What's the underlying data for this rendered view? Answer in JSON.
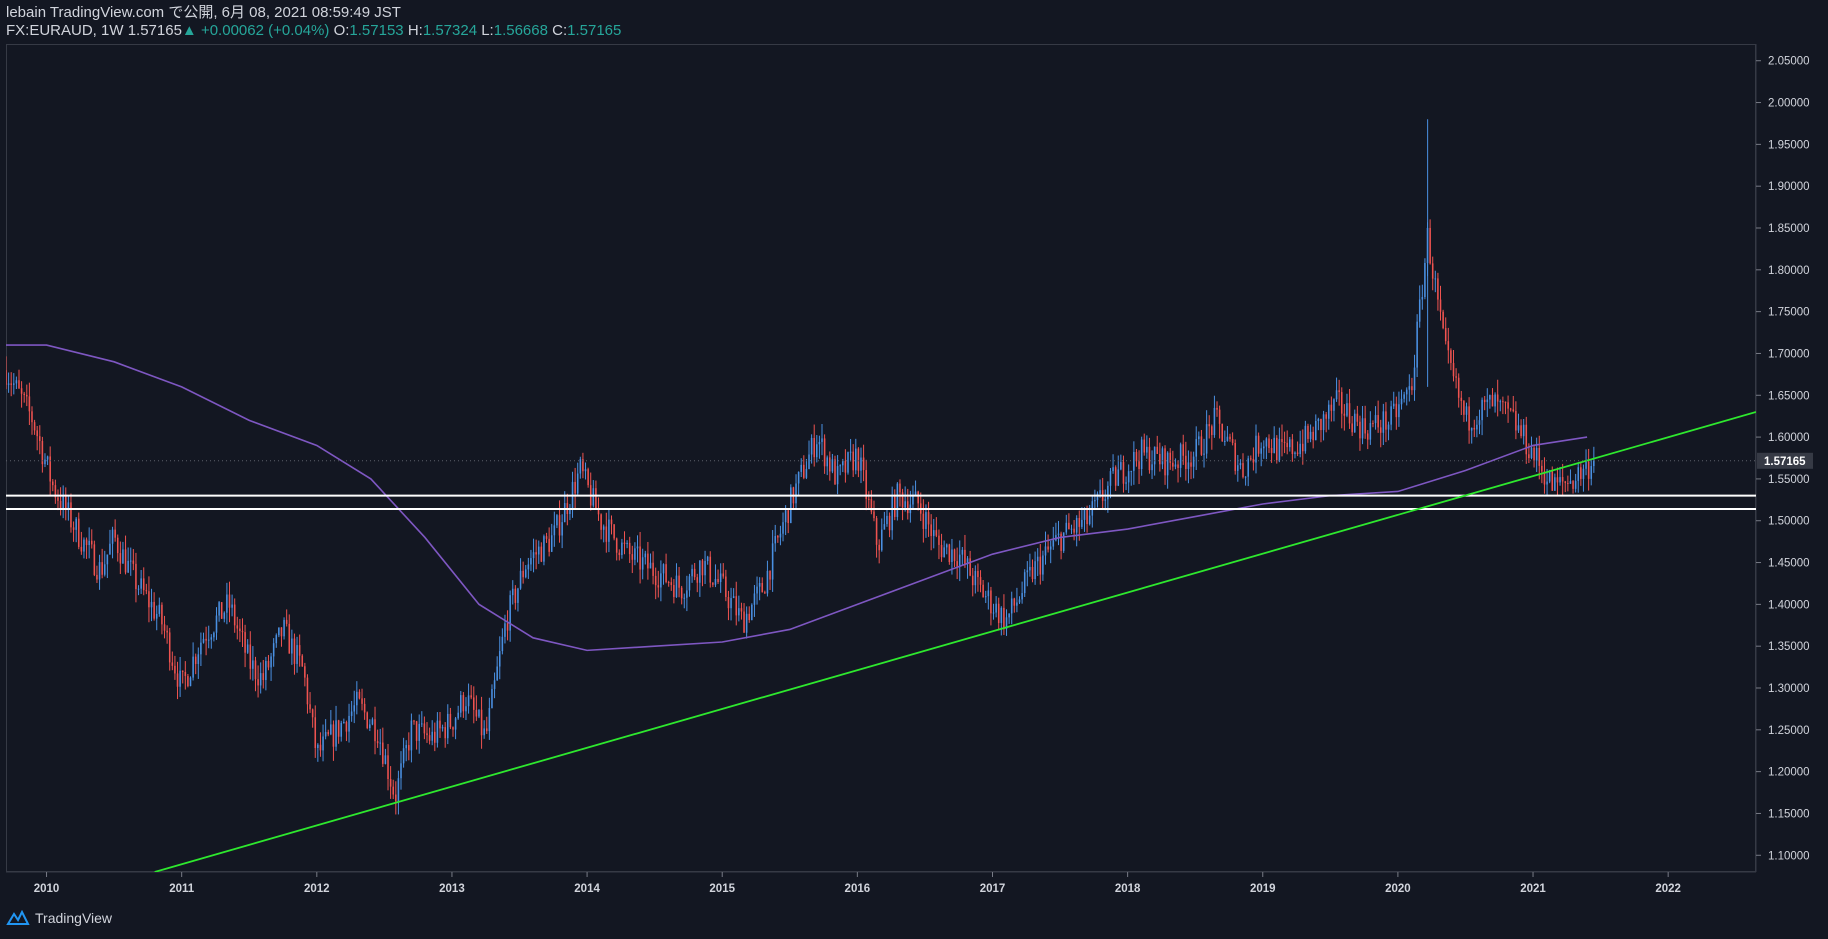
{
  "header": {
    "published_line": "lebain TradingView.com で公開, 6月 08, 2021 08:59:49 JST",
    "symbol": "FX:EURAUD, 1W",
    "last": "1.57165",
    "change": "+0.00062 (+0.04%)",
    "open_label": "O:",
    "open": "1.57153",
    "high_label": "H:",
    "high": "1.57324",
    "low_label": "L:",
    "low": "1.56668",
    "close_label": "C:",
    "close": "1.57165",
    "up_marker": "▲"
  },
  "footer": {
    "brand": "TradingView"
  },
  "colors": {
    "background": "#131722",
    "up": "#4a90e2",
    "down": "#ef5350",
    "ma": "#7e57c2",
    "trendline": "#2ee82e",
    "hline": "#ffffff",
    "ohlc_values": "#26a69a",
    "axis_text": "#d1d4dc"
  },
  "chart_data": {
    "type": "candlestick",
    "symbol": "FX:EURAUD",
    "interval": "1W",
    "x_range": [
      2009.7,
      2022.65
    ],
    "ylim": [
      1.08,
      2.07
    ],
    "y_ticks": [
      "2.05000",
      "2.00000",
      "1.95000",
      "1.90000",
      "1.85000",
      "1.80000",
      "1.75000",
      "1.70000",
      "1.65000",
      "1.60000",
      "1.55000",
      "1.50000",
      "1.45000",
      "1.40000",
      "1.35000",
      "1.30000",
      "1.25000",
      "1.20000",
      "1.15000",
      "1.10000"
    ],
    "x_ticks": [
      "2010",
      "2011",
      "2012",
      "2013",
      "2014",
      "2015",
      "2016",
      "2017",
      "2018",
      "2019",
      "2020",
      "2021",
      "2022"
    ],
    "last_price_label": "1.57165",
    "last_price": 1.57165,
    "price_path": [
      [
        2009.7,
        1.68
      ],
      [
        2009.9,
        1.62
      ],
      [
        2010.05,
        1.54
      ],
      [
        2010.25,
        1.48
      ],
      [
        2010.4,
        1.44
      ],
      [
        2010.5,
        1.48
      ],
      [
        2010.65,
        1.43
      ],
      [
        2010.85,
        1.38
      ],
      [
        2011.0,
        1.3
      ],
      [
        2011.15,
        1.36
      ],
      [
        2011.35,
        1.4
      ],
      [
        2011.5,
        1.33
      ],
      [
        2011.6,
        1.31
      ],
      [
        2011.75,
        1.37
      ],
      [
        2011.9,
        1.32
      ],
      [
        2012.0,
        1.22
      ],
      [
        2012.15,
        1.25
      ],
      [
        2012.3,
        1.28
      ],
      [
        2012.45,
        1.25
      ],
      [
        2012.58,
        1.17
      ],
      [
        2012.7,
        1.25
      ],
      [
        2012.85,
        1.24
      ],
      [
        2013.0,
        1.26
      ],
      [
        2013.1,
        1.29
      ],
      [
        2013.25,
        1.24
      ],
      [
        2013.4,
        1.38
      ],
      [
        2013.55,
        1.45
      ],
      [
        2013.75,
        1.48
      ],
      [
        2013.95,
        1.56
      ],
      [
        2014.1,
        1.5
      ],
      [
        2014.3,
        1.46
      ],
      [
        2014.5,
        1.44
      ],
      [
        2014.7,
        1.42
      ],
      [
        2014.85,
        1.45
      ],
      [
        2015.0,
        1.42
      ],
      [
        2015.15,
        1.38
      ],
      [
        2015.3,
        1.42
      ],
      [
        2015.5,
        1.52
      ],
      [
        2015.7,
        1.6
      ],
      [
        2015.85,
        1.55
      ],
      [
        2016.0,
        1.58
      ],
      [
        2016.15,
        1.47
      ],
      [
        2016.3,
        1.53
      ],
      [
        2016.45,
        1.52
      ],
      [
        2016.6,
        1.47
      ],
      [
        2016.75,
        1.46
      ],
      [
        2016.9,
        1.42
      ],
      [
        2017.1,
        1.38
      ],
      [
        2017.3,
        1.44
      ],
      [
        2017.5,
        1.48
      ],
      [
        2017.7,
        1.5
      ],
      [
        2017.9,
        1.55
      ],
      [
        2018.1,
        1.58
      ],
      [
        2018.3,
        1.57
      ],
      [
        2018.5,
        1.58
      ],
      [
        2018.65,
        1.62
      ],
      [
        2018.85,
        1.56
      ],
      [
        2019.0,
        1.6
      ],
      [
        2019.15,
        1.58
      ],
      [
        2019.35,
        1.6
      ],
      [
        2019.55,
        1.64
      ],
      [
        2019.75,
        1.61
      ],
      [
        2019.95,
        1.62
      ],
      [
        2020.1,
        1.66
      ],
      [
        2020.22,
        1.84
      ],
      [
        2020.35,
        1.7
      ],
      [
        2020.5,
        1.62
      ],
      [
        2020.7,
        1.64
      ],
      [
        2020.85,
        1.62
      ],
      [
        2021.0,
        1.58
      ],
      [
        2021.15,
        1.54
      ],
      [
        2021.3,
        1.55
      ],
      [
        2021.45,
        1.57165
      ]
    ],
    "moving_average": [
      [
        2009.7,
        1.71
      ],
      [
        2010.0,
        1.71
      ],
      [
        2010.5,
        1.69
      ],
      [
        2011.0,
        1.66
      ],
      [
        2011.5,
        1.62
      ],
      [
        2012.0,
        1.59
      ],
      [
        2012.4,
        1.55
      ],
      [
        2012.8,
        1.48
      ],
      [
        2013.2,
        1.4
      ],
      [
        2013.6,
        1.36
      ],
      [
        2014.0,
        1.345
      ],
      [
        2014.5,
        1.35
      ],
      [
        2015.0,
        1.355
      ],
      [
        2015.5,
        1.37
      ],
      [
        2016.0,
        1.4
      ],
      [
        2016.5,
        1.43
      ],
      [
        2017.0,
        1.46
      ],
      [
        2017.5,
        1.48
      ],
      [
        2018.0,
        1.49
      ],
      [
        2018.5,
        1.505
      ],
      [
        2019.0,
        1.52
      ],
      [
        2019.5,
        1.53
      ],
      [
        2020.0,
        1.535
      ],
      [
        2020.5,
        1.56
      ],
      [
        2021.0,
        1.59
      ],
      [
        2021.4,
        1.6
      ]
    ],
    "trend_line": {
      "from": [
        2010.8,
        1.08
      ],
      "to": [
        2022.65,
        1.63
      ]
    },
    "horizontal_lines": [
      1.53,
      1.514
    ]
  }
}
